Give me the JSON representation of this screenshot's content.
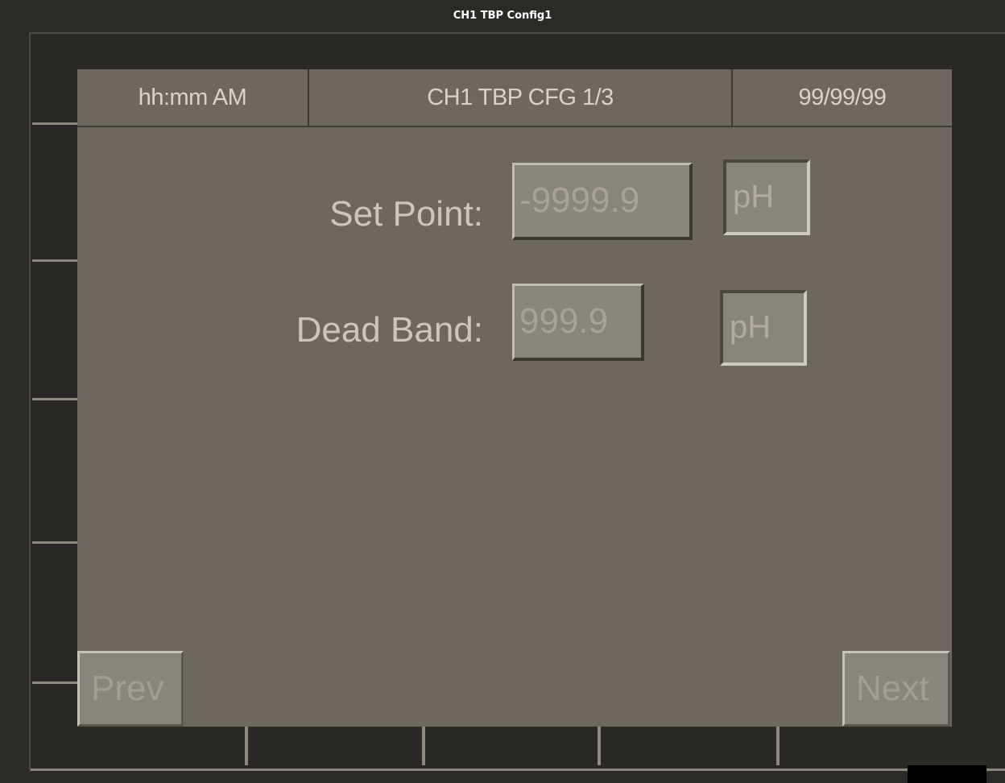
{
  "window": {
    "title": "CH1 TBP Config1"
  },
  "header": {
    "time": "hh:mm AM",
    "screen_title": "CH1 TBP CFG 1/3",
    "date": "99/99/99"
  },
  "fields": {
    "set_point": {
      "label": "Set Point:",
      "value": "-9999.9",
      "unit": "pH"
    },
    "dead_band": {
      "label": "Dead Band:",
      "value": "999.9",
      "unit": "pH"
    }
  },
  "nav": {
    "prev_label": "Prev",
    "next_label": "Next"
  },
  "colors": {
    "panel": "#6d6760",
    "frame": "#2b2a27",
    "title_text": "#ffffff"
  }
}
